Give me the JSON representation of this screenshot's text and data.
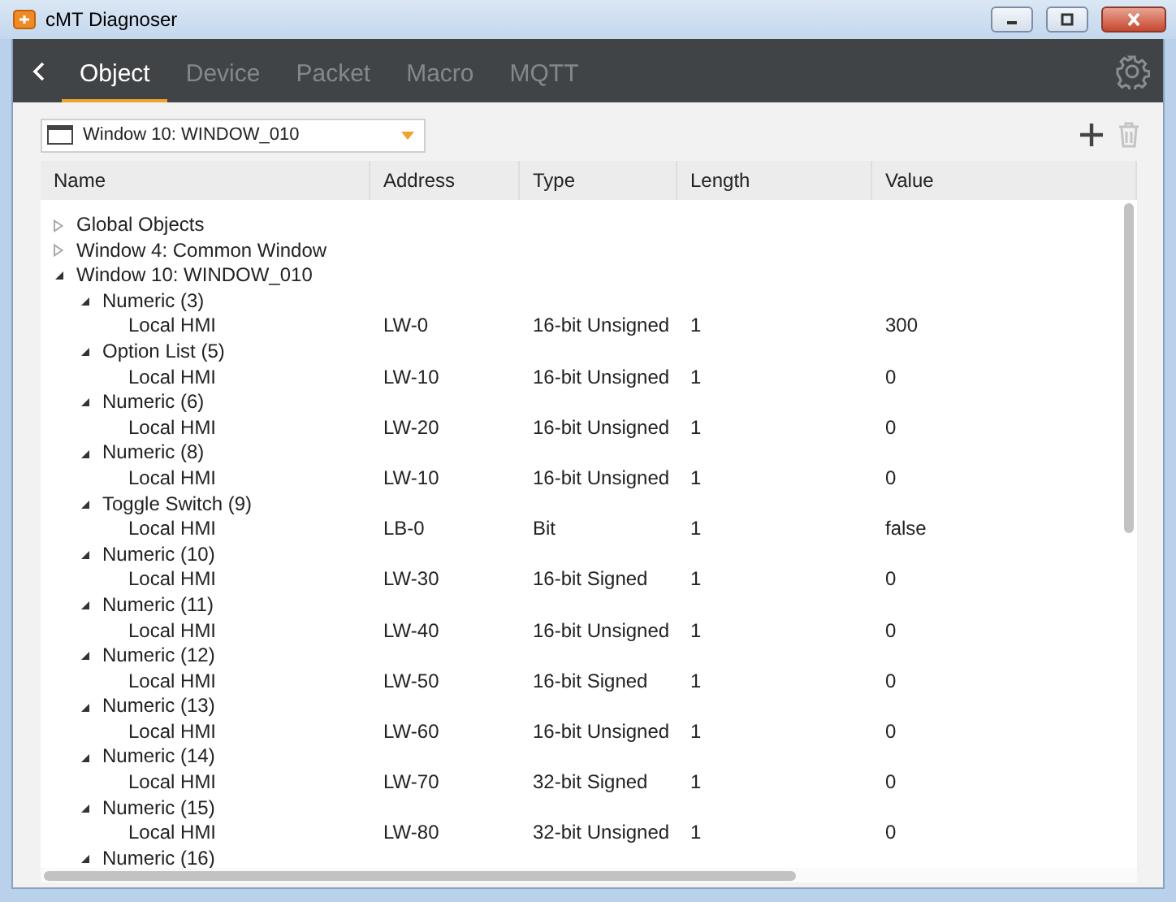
{
  "window": {
    "title": "cMT Diagnoser"
  },
  "tabs": [
    {
      "label": "Object",
      "selected": true
    },
    {
      "label": "Device",
      "selected": false
    },
    {
      "label": "Packet",
      "selected": false
    },
    {
      "label": "Macro",
      "selected": false
    },
    {
      "label": "MQTT",
      "selected": false
    }
  ],
  "window_select": {
    "value": "Window 10: WINDOW_010"
  },
  "table": {
    "columns": [
      "Name",
      "Address",
      "Type",
      "Length",
      "Value"
    ],
    "tree": [
      {
        "name": "Global Objects",
        "expanded": false
      },
      {
        "name": "Window 4: Common Window",
        "expanded": false
      },
      {
        "name": "Window 10: WINDOW_010",
        "expanded": true,
        "children": [
          {
            "name": "Numeric (3)",
            "expanded": true,
            "children": [
              {
                "name": "Local HMI",
                "address": "LW-0",
                "type": "16-bit Unsigned",
                "length": "1",
                "value": "300"
              }
            ]
          },
          {
            "name": "Option List (5)",
            "expanded": true,
            "children": [
              {
                "name": "Local HMI",
                "address": "LW-10",
                "type": "16-bit Unsigned",
                "length": "1",
                "value": "0"
              }
            ]
          },
          {
            "name": "Numeric (6)",
            "expanded": true,
            "children": [
              {
                "name": "Local HMI",
                "address": "LW-20",
                "type": "16-bit Unsigned",
                "length": "1",
                "value": "0"
              }
            ]
          },
          {
            "name": "Numeric (8)",
            "expanded": true,
            "children": [
              {
                "name": "Local HMI",
                "address": "LW-10",
                "type": "16-bit Unsigned",
                "length": "1",
                "value": "0"
              }
            ]
          },
          {
            "name": "Toggle Switch (9)",
            "expanded": true,
            "children": [
              {
                "name": "Local HMI",
                "address": "LB-0",
                "type": "Bit",
                "length": "1",
                "value": "false"
              }
            ]
          },
          {
            "name": "Numeric (10)",
            "expanded": true,
            "children": [
              {
                "name": "Local HMI",
                "address": "LW-30",
                "type": "16-bit Signed",
                "length": "1",
                "value": "0"
              }
            ]
          },
          {
            "name": "Numeric (11)",
            "expanded": true,
            "children": [
              {
                "name": "Local HMI",
                "address": "LW-40",
                "type": "16-bit Unsigned",
                "length": "1",
                "value": "0"
              }
            ]
          },
          {
            "name": "Numeric (12)",
            "expanded": true,
            "children": [
              {
                "name": "Local HMI",
                "address": "LW-50",
                "type": "16-bit Signed",
                "length": "1",
                "value": "0"
              }
            ]
          },
          {
            "name": "Numeric (13)",
            "expanded": true,
            "children": [
              {
                "name": "Local HMI",
                "address": "LW-60",
                "type": "16-bit Unsigned",
                "length": "1",
                "value": "0"
              }
            ]
          },
          {
            "name": "Numeric (14)",
            "expanded": true,
            "children": [
              {
                "name": "Local HMI",
                "address": "LW-70",
                "type": "32-bit Signed",
                "length": "1",
                "value": "0"
              }
            ]
          },
          {
            "name": "Numeric (15)",
            "expanded": true,
            "children": [
              {
                "name": "Local HMI",
                "address": "LW-80",
                "type": "32-bit Unsigned",
                "length": "1",
                "value": "0"
              }
            ]
          },
          {
            "name": "Numeric (16)",
            "expanded": true
          }
        ]
      }
    ]
  }
}
